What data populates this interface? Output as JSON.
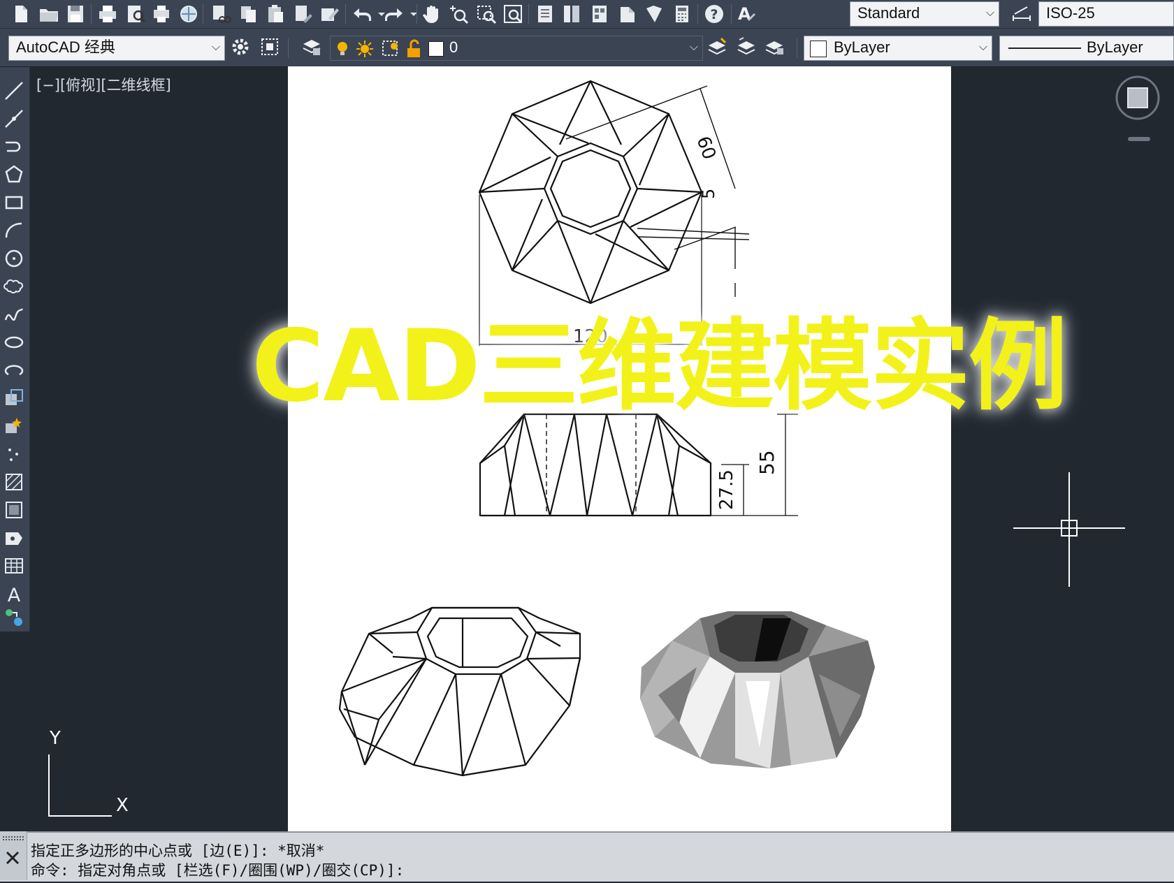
{
  "toolbar": {
    "text_style": "Standard",
    "dim_style": "ISO-25",
    "workspace": "AutoCAD 经典",
    "layer": "0",
    "color": "ByLayer",
    "linetype": "ByLayer"
  },
  "viewport": {
    "label": "[−][俯视][二维线框]"
  },
  "drawing": {
    "dim_60": "60",
    "dim_5": "5",
    "dim_120": "120",
    "dim_55": "55",
    "dim_27_5": "27.5"
  },
  "overlay_title": "CAD三维建模实例",
  "ucs": {
    "x": "X",
    "y": "Y"
  },
  "command": {
    "line1": "指定正多边形的中心点或 [边(E)]: *取消*",
    "line2": "命令: 指定对角点或 [栏选(F)/圈围(WP)/圈交(CP)]:"
  },
  "colors": {
    "ui_bg": "#3b4453",
    "canvas_bg": "#212830",
    "overlay_text": "#f2f21a"
  }
}
